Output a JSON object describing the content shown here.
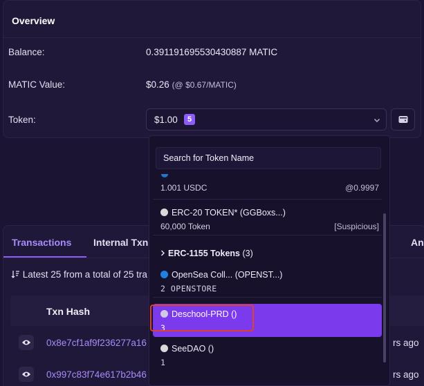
{
  "overview": {
    "title": "Overview",
    "balance_label": "Balance:",
    "balance_value": "0.391191695530430887 MATIC",
    "matic_value_label": "MATIC Value:",
    "matic_value": "$0.26",
    "matic_rate": "(@ $0.67/MATIC)",
    "token_label": "Token:",
    "token_amount": "$1.00",
    "token_count": "5"
  },
  "tabs": [
    {
      "label": "Transactions"
    },
    {
      "label": "Internal Txns"
    },
    {
      "label": "Ana"
    }
  ],
  "transactions": {
    "summary": "Latest 25 from a total of 25 tra",
    "column_txn_hash": "Txn Hash",
    "rows": [
      {
        "hash": "0x8e7cf1af9f236277a16",
        "age": "rs ago"
      },
      {
        "hash": "0x997c83f74e617b2b46",
        "age": "rs ago"
      }
    ]
  },
  "dropdown": {
    "search_placeholder": "Search for Token Name",
    "items": [
      {
        "sub": "1.001 USDC",
        "right": "@0.9997"
      },
      {
        "name": "ERC-20 TOKEN* (GGBoxs...)",
        "sub": "60,000 Token",
        "right": "[Suspicious]"
      },
      {
        "name": "OpenSea Coll... (OPENST...)",
        "sub": "2 OPENSTORE"
      },
      {
        "name": "Deschool-PRD ()",
        "sub": "3"
      },
      {
        "name": "SeeDAO ()",
        "sub": "1"
      }
    ],
    "group": {
      "label": "ERC-1155 Tokens",
      "count": "(3)"
    }
  },
  "colors": {
    "background": "#1b1433",
    "card": "#201838",
    "accent": "#8b5cf6",
    "selected": "#7c3aed",
    "highlight": "#e0402e"
  }
}
